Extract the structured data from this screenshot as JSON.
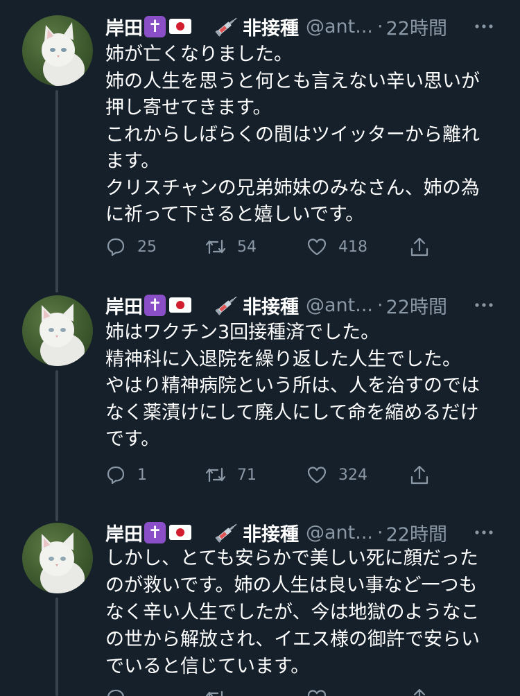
{
  "author": {
    "name": "岸田",
    "status": "非接種",
    "handle": "@ant...",
    "time_separator": "·",
    "time": "22時間"
  },
  "colors": {
    "background": "#15202b",
    "text": "#ffffff",
    "muted": "#8b98a5",
    "thread_line": "#38444d",
    "cross_emoji_bg": "#8a4fc7"
  },
  "icons": {
    "cross": "✝",
    "reply": "reply-icon",
    "retweet": "retweet-icon",
    "like": "heart-icon",
    "share": "share-icon",
    "more": "more-icon"
  },
  "tweets": [
    {
      "lines": [
        "姉が亡くなりました。",
        "姉の人生を思うと何とも言えない辛い思いが",
        "押し寄せてきます。",
        "これからしばらくの間はツイッターから離れ",
        "ます。",
        "クリスチャンの兄弟姉妹のみなさん、姉の為",
        "に祈って下さると嬉しいです。"
      ],
      "replies": "25",
      "retweets": "54",
      "likes": "418"
    },
    {
      "lines": [
        "姉はワクチン3回接種済でした。",
        "精神科に入退院を繰り返した人生でした。",
        "やはり精神病院という所は、人を治すのでは",
        "なく薬漬けにして廃人にして命を縮めるだけ",
        "です。"
      ],
      "replies": "1",
      "retweets": "71",
      "likes": "324"
    },
    {
      "lines": [
        "しかし、とても安らかで美しい死に顔だった",
        "のが救いです。姉の人生は良い事など一つも",
        "なく辛い人生でしたが、今は地獄のようなこ",
        "の世から解放され、イエス様の御許で安らい",
        "でいると信じています。"
      ],
      "replies": "",
      "retweets": "",
      "likes": ""
    }
  ]
}
